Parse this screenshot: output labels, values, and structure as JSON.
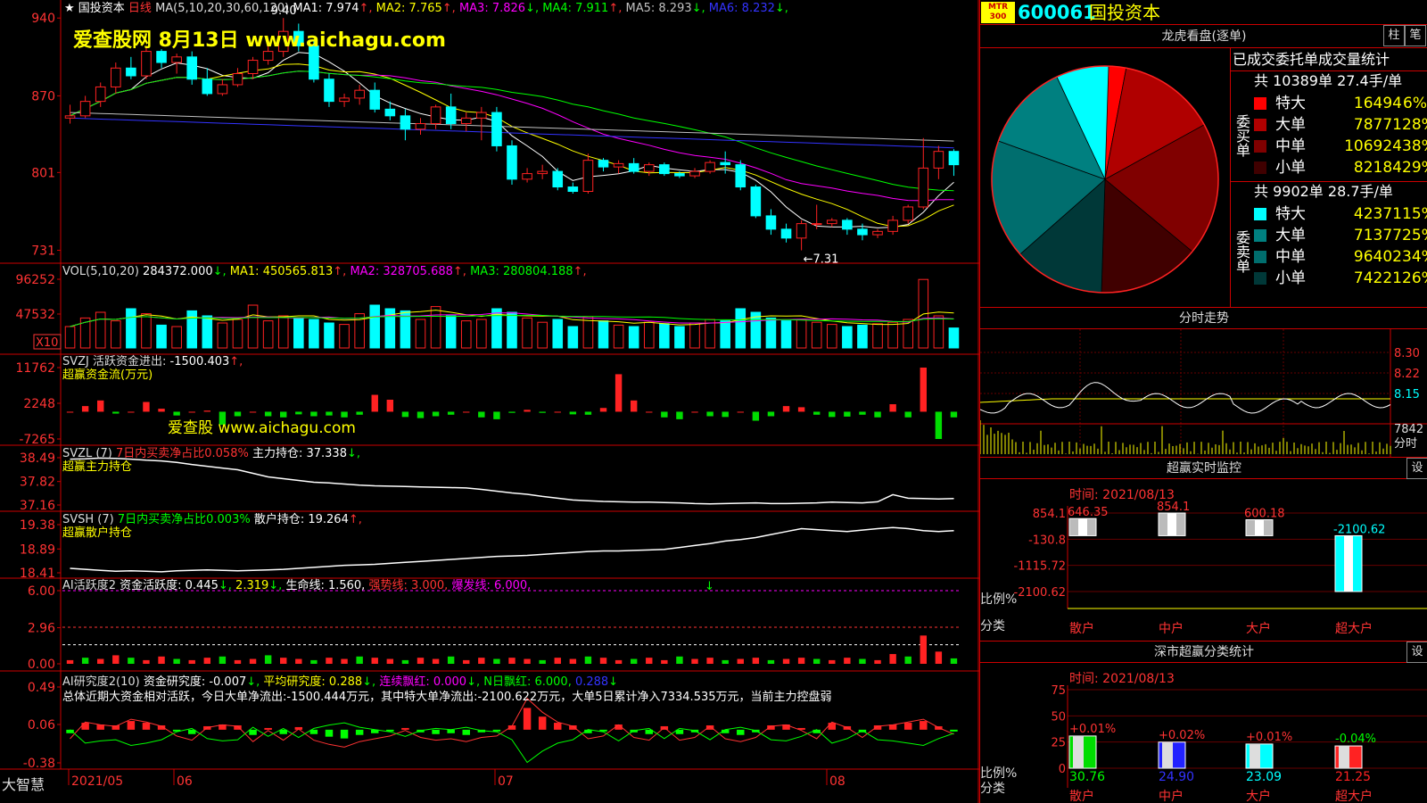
{
  "app": {
    "name": "大智慧",
    "stock_name": "国投资本",
    "period": "日线",
    "watermark": "爱查股网    8月13日   www.aichagu.com",
    "watermark2": "爱查股 www.aichagu.com"
  },
  "colors": {
    "up": "#ff2222",
    "down": "#00ffff",
    "ma1": "#ffffff",
    "ma2": "#ffff00",
    "ma3": "#ff00ff",
    "ma4": "#00ff00",
    "ma5": "#c0c0c0",
    "ma6": "#3333ff"
  },
  "price_panel": {
    "title": "国投资本",
    "ma_label": "MA(5,10,20,30,60,120)",
    "ma_values": [
      {
        "label": "MA1:",
        "value": "7.974",
        "arrow": "↑",
        "color": "#ffffff"
      },
      {
        "label": "MA2:",
        "value": "7.765",
        "arrow": "↑",
        "color": "#ffff00"
      },
      {
        "label": "MA3:",
        "value": "7.826",
        "arrow": "↓",
        "color": "#ff00ff"
      },
      {
        "label": "MA4:",
        "value": "7.911",
        "arrow": "↑",
        "color": "#00ff00"
      },
      {
        "label": "MA5:",
        "value": "8.293",
        "arrow": "↓",
        "color": "#c0c0c0"
      },
      {
        "label": "MA6:",
        "value": "8.232",
        "arrow": "↓",
        "color": "#3333ff"
      }
    ],
    "high_label": "9.40",
    "low_label": "←7.31",
    "yticks": [
      "940",
      "870",
      "801",
      "731"
    ]
  },
  "vol_panel": {
    "label": "VOL(5,10,20)",
    "value": "284372.000",
    "arrow": "↓",
    "ma": [
      {
        "label": "MA1:",
        "value": "450565.813",
        "arrow": "↑",
        "color": "#ffff00"
      },
      {
        "label": "MA2:",
        "value": "328705.688",
        "arrow": "↑",
        "color": "#ff00ff"
      },
      {
        "label": "MA3:",
        "value": "280804.188",
        "arrow": "↑",
        "color": "#00ff00"
      }
    ],
    "yticks": [
      "96252",
      "47532"
    ],
    "unit": "X10"
  },
  "svzj_panel": {
    "label": "SVZJ  活跃资金进出:",
    "value": "-1500.403",
    "arrow": "↑",
    "sub": "超赢资金流(万元)",
    "yticks": [
      "11762",
      "2248",
      "-7265"
    ]
  },
  "svzl_panel": {
    "label": "SVZL (7)",
    "desc": "7日内买卖净占比0.058%",
    "extra": "主力持仓:",
    "value": "37.338",
    "arrow": "↓",
    "sub": "超赢主力持仓",
    "yticks": [
      "38.49",
      "37.82",
      "37.16"
    ]
  },
  "svsh_panel": {
    "label": "SVSH (7)",
    "desc": "7日内买卖净占比0.003%",
    "extra": "散户持仓:",
    "value": "19.264",
    "arrow": "↑",
    "sub": "超赢散户持仓",
    "yticks": [
      "19.38",
      "18.89",
      "18.41"
    ]
  },
  "ai1_panel": {
    "label": "AI活跃度2",
    "text1": "资金活跃度:",
    "v1": "0.445",
    "v2": "2.319",
    "text2": "生命线:",
    "v3": "1.560",
    "text3": "强势线:",
    "v4": "3.000",
    "text4": "爆发线:",
    "v5": "6.000",
    "yticks": [
      "6.00",
      "2.96",
      "0.00"
    ]
  },
  "ai2_panel": {
    "label": "AI研究度2(10)",
    "text1": "资金研究度:",
    "v1": "-0.007",
    "text2": "平均研究度:",
    "v2": "0.288",
    "text3": "连续飘红:",
    "v3": "0.000",
    "text4": "N日飘红:",
    "v4": "6.000",
    "v5": "0.288",
    "summary": "总体近期大资金相对活跃，今日大单净流出:-1500.444万元，其中特大单净流出:-2100.622万元，大单5日累计净入7334.535万元，当前主力控盘弱",
    "yticks": [
      "0.49",
      "0.06",
      "-0.38"
    ]
  },
  "xaxis": {
    "labels": [
      "2021/05",
      "06",
      "07",
      "08"
    ]
  },
  "right": {
    "code": "600061",
    "name": "国投资本",
    "tag": "MTR 300",
    "dragon_title": "龙虎看盘(逐单)",
    "btn1": "柱",
    "btn2": "笔",
    "order_title": "已成交委托单成交量统计",
    "buy": {
      "side": "委买单",
      "summary": "共 10389单 27.4手/单",
      "rows": [
        {
          "name": "特大",
          "vol": "16494",
          "pct": "6%",
          "color": "#ff0000"
        },
        {
          "name": "大单",
          "vol": "78771",
          "pct": "28%",
          "color": "#b00000"
        },
        {
          "name": "中单",
          "vol": "106924",
          "pct": "38%",
          "color": "#800000"
        },
        {
          "name": "小单",
          "vol": "82184",
          "pct": "29%",
          "color": "#400000"
        }
      ]
    },
    "sell": {
      "side": "委卖单",
      "summary": "共 9902单 28.7手/单",
      "rows": [
        {
          "name": "特大",
          "vol": "42371",
          "pct": "15%",
          "color": "#00ffff"
        },
        {
          "name": "大单",
          "vol": "71377",
          "pct": "25%",
          "color": "#008080"
        },
        {
          "name": "中单",
          "vol": "96402",
          "pct": "34%",
          "color": "#006e6e"
        },
        {
          "name": "小单",
          "vol": "74221",
          "pct": "26%",
          "color": "#003838"
        }
      ]
    },
    "intraday": {
      "title": "分时走势",
      "prices": [
        "8.30",
        "8.22",
        "8.15"
      ],
      "vol": "7842",
      "unit": "分时"
    },
    "monitor": {
      "title": "超赢实时监控",
      "btn": "设",
      "time": "时间: 2021/08/13",
      "ylabels": [
        "854.1",
        "-130.8",
        "-1115.72",
        "-2100.62"
      ],
      "ratio": "比例%",
      "cat": "分类",
      "bars": [
        {
          "name": "散户",
          "value": 646.35,
          "label": "646.35"
        },
        {
          "name": "中户",
          "value": 854.1,
          "label": "854.1"
        },
        {
          "name": "大户",
          "value": 600.18,
          "label": "600.18"
        },
        {
          "name": "超大户",
          "value": -2100.62,
          "label": "-2100.62"
        }
      ]
    },
    "stats": {
      "title": "深市超赢分类统计",
      "btn": "设",
      "time": "时间: 2021/08/13",
      "ylabels": [
        "75",
        "50",
        "25",
        "0"
      ],
      "ratio": "比例%",
      "cat": "分类",
      "bars": [
        {
          "name": "散户",
          "value": 30.76,
          "change": "+0.01%",
          "color": "#00dd00"
        },
        {
          "name": "中户",
          "value": 24.9,
          "change": "+0.02%",
          "color": "#2222ff"
        },
        {
          "name": "大户",
          "value": 23.09,
          "change": "+0.01%",
          "color": "#00ffff"
        },
        {
          "name": "超大户",
          "value": 21.25,
          "change": "-0.04%",
          "color": "#ff2222"
        }
      ]
    }
  },
  "chart_data": {
    "type": "candlestick",
    "title": "国投资本 日线",
    "xlabel": "",
    "ylabel": "",
    "ylim": [
      7.25,
      9.45
    ],
    "ohlc": [
      [
        8.5,
        8.62,
        8.45,
        8.52
      ],
      [
        8.52,
        8.7,
        8.5,
        8.65
      ],
      [
        8.65,
        8.82,
        8.6,
        8.78
      ],
      [
        8.78,
        9.0,
        8.72,
        8.95
      ],
      [
        8.95,
        9.05,
        8.85,
        8.88
      ],
      [
        8.88,
        9.15,
        8.85,
        9.1
      ],
      [
        9.1,
        9.12,
        8.95,
        9.0
      ],
      [
        9.0,
        9.08,
        8.9,
        9.05
      ],
      [
        9.05,
        9.1,
        8.8,
        8.85
      ],
      [
        8.85,
        8.95,
        8.7,
        8.72
      ],
      [
        8.72,
        8.85,
        8.7,
        8.8
      ],
      [
        8.8,
        8.95,
        8.78,
        8.9
      ],
      [
        8.9,
        9.05,
        8.85,
        9.02
      ],
      [
        9.02,
        9.15,
        8.98,
        9.1
      ],
      [
        9.1,
        9.4,
        9.05,
        9.28
      ],
      [
        9.28,
        9.35,
        9.1,
        9.15
      ],
      [
        9.15,
        9.2,
        8.82,
        8.85
      ],
      [
        8.85,
        8.9,
        8.6,
        8.65
      ],
      [
        8.65,
        8.72,
        8.6,
        8.68
      ],
      [
        8.68,
        8.8,
        8.62,
        8.75
      ],
      [
        8.75,
        8.82,
        8.55,
        8.58
      ],
      [
        8.58,
        8.65,
        8.48,
        8.52
      ],
      [
        8.52,
        8.58,
        8.3,
        8.4
      ],
      [
        8.4,
        8.5,
        8.35,
        8.45
      ],
      [
        8.45,
        8.62,
        8.4,
        8.6
      ],
      [
        8.6,
        8.72,
        8.4,
        8.45
      ],
      [
        8.45,
        8.55,
        8.38,
        8.5
      ],
      [
        8.5,
        8.6,
        8.3,
        8.55
      ],
      [
        8.55,
        8.6,
        8.2,
        8.25
      ],
      [
        8.25,
        8.3,
        7.9,
        7.95
      ],
      [
        7.95,
        8.05,
        7.92,
        8.0
      ],
      [
        8.0,
        8.08,
        7.95,
        8.02
      ],
      [
        8.02,
        8.05,
        7.85,
        7.88
      ],
      [
        7.88,
        7.92,
        7.82,
        7.84
      ],
      [
        7.84,
        8.18,
        7.82,
        8.12
      ],
      [
        8.12,
        8.14,
        8.02,
        8.06
      ],
      [
        8.06,
        8.12,
        8.0,
        8.09
      ],
      [
        8.09,
        8.14,
        8.0,
        8.02
      ],
      [
        8.02,
        8.1,
        7.98,
        8.08
      ],
      [
        8.08,
        8.1,
        7.98,
        8.0
      ],
      [
        8.0,
        8.02,
        7.96,
        7.98
      ],
      [
        7.98,
        8.05,
        7.96,
        8.02
      ],
      [
        8.02,
        8.12,
        8.0,
        8.1
      ],
      [
        8.1,
        8.2,
        8.0,
        8.08
      ],
      [
        8.08,
        8.12,
        7.85,
        7.88
      ],
      [
        7.88,
        7.9,
        7.6,
        7.62
      ],
      [
        7.62,
        7.68,
        7.45,
        7.5
      ],
      [
        7.5,
        7.55,
        7.38,
        7.42
      ],
      [
        7.42,
        7.58,
        7.31,
        7.55
      ],
      [
        7.55,
        7.72,
        7.5,
        7.55
      ],
      [
        7.55,
        7.6,
        7.52,
        7.58
      ],
      [
        7.58,
        7.6,
        7.45,
        7.5
      ],
      [
        7.5,
        7.55,
        7.4,
        7.45
      ],
      [
        7.45,
        7.5,
        7.42,
        7.48
      ],
      [
        7.48,
        7.62,
        7.45,
        7.58
      ],
      [
        7.58,
        7.72,
        7.55,
        7.7
      ],
      [
        7.7,
        8.32,
        7.68,
        8.05
      ],
      [
        8.05,
        8.25,
        7.95,
        8.2
      ],
      [
        8.2,
        8.22,
        7.98,
        8.08
      ]
    ],
    "volume_x10": [
      30000,
      42000,
      50000,
      38000,
      55000,
      48000,
      32000,
      30000,
      52000,
      45000,
      35000,
      40000,
      60000,
      38000,
      45000,
      42000,
      40000,
      35000,
      33000,
      48000,
      60000,
      55000,
      52000,
      40000,
      58000,
      45000,
      38000,
      40000,
      55000,
      50000,
      42000,
      36000,
      40000,
      30000,
      44000,
      38000,
      32000,
      30000,
      36000,
      34000,
      30000,
      35000,
      40000,
      38000,
      55000,
      50000,
      42000,
      38000,
      40000,
      36000,
      33000,
      30000,
      32000,
      34000,
      36000,
      40000,
      96000,
      45000,
      28000
    ],
    "svzj": [
      0,
      1500,
      3000,
      -500,
      0,
      2600,
      800,
      -1000,
      0,
      300,
      -3500,
      -1200,
      0,
      -1200,
      -1500,
      -700,
      -1200,
      -1000,
      -1500,
      -800,
      4500,
      3200,
      -1400,
      -1700,
      -1200,
      -800,
      0,
      -1500,
      -2000,
      -300,
      500,
      -300,
      0,
      -700,
      -800,
      1000,
      10000,
      3000,
      0,
      -1500,
      -2000,
      0,
      -1200,
      -1400,
      0,
      -2400,
      -1200,
      1500,
      1200,
      -800,
      -1400,
      -1300,
      -800,
      -1500,
      2000,
      -1500,
      11762,
      -7265,
      -1500
    ],
    "svzl": [
      38.45,
      38.46,
      38.48,
      38.47,
      38.45,
      38.42,
      38.4,
      38.36,
      38.3,
      38.25,
      38.2,
      38.15,
      38.05,
      37.95,
      37.9,
      37.85,
      37.8,
      37.78,
      37.75,
      37.72,
      37.7,
      37.69,
      37.68,
      37.67,
      37.66,
      37.65,
      37.64,
      37.6,
      37.55,
      37.5,
      37.46,
      37.4,
      37.35,
      37.3,
      37.28,
      37.26,
      37.25,
      37.24,
      37.24,
      37.23,
      37.22,
      37.2,
      37.19,
      37.2,
      37.21,
      37.22,
      37.2,
      37.2,
      37.21,
      37.22,
      37.24,
      37.23,
      37.22,
      37.25,
      37.45,
      37.35,
      37.34,
      37.33,
      37.34
    ],
    "svsh": [
      18.5,
      18.48,
      18.46,
      18.44,
      18.45,
      18.44,
      18.43,
      18.45,
      18.46,
      18.47,
      18.46,
      18.45,
      18.46,
      18.47,
      18.48,
      18.5,
      18.52,
      18.54,
      18.56,
      18.57,
      18.58,
      18.6,
      18.62,
      18.64,
      18.66,
      18.68,
      18.7,
      18.72,
      18.74,
      18.75,
      18.76,
      18.78,
      18.8,
      18.82,
      18.84,
      18.85,
      18.85,
      18.86,
      18.87,
      18.88,
      18.92,
      18.96,
      19.0,
      19.05,
      19.08,
      19.12,
      19.18,
      19.24,
      19.3,
      19.28,
      19.26,
      19.24,
      19.27,
      19.3,
      19.32,
      19.3,
      19.26,
      19.24,
      19.26
    ],
    "ai1": [
      0.3,
      0.5,
      0.4,
      0.7,
      0.5,
      0.3,
      0.6,
      0.4,
      0.3,
      0.5,
      0.6,
      0.3,
      0.4,
      0.7,
      0.5,
      0.4,
      0.3,
      0.5,
      0.4,
      0.6,
      0.5,
      0.4,
      0.3,
      0.5,
      0.4,
      0.6,
      0.3,
      0.5,
      0.4,
      0.5,
      0.4,
      0.3,
      0.5,
      0.4,
      0.6,
      0.5,
      0.3,
      0.4,
      0.5,
      0.3,
      0.6,
      0.4,
      0.5,
      0.3,
      0.4,
      0.5,
      0.3,
      0.4,
      0.5,
      0.4,
      0.3,
      0.5,
      0.4,
      0.3,
      0.8,
      0.6,
      2.319,
      1.0,
      0.445
    ],
    "ai2": [
      -0.04,
      0.08,
      0.06,
      0.05,
      0.1,
      0.08,
      0.05,
      -0.02,
      -0.05,
      0.04,
      0.06,
      0.05,
      -0.06,
      0.02,
      -0.05,
      0.03,
      -0.05,
      -0.08,
      -0.1,
      -0.06,
      -0.04,
      -0.02,
      0.02,
      -0.03,
      -0.05,
      -0.04,
      -0.06,
      -0.03,
      -0.02,
      0.05,
      0.25,
      0.15,
      0.08,
      0.05,
      -0.04,
      -0.02,
      0.06,
      -0.03,
      -0.05,
      0.04,
      -0.05,
      -0.03,
      0.05,
      -0.04,
      -0.06,
      -0.03,
      0.05,
      0.06,
      0.02,
      -0.04,
      0.08,
      0.04,
      -0.03,
      0.05,
      0.06,
      0.08,
      0.1,
      0.04,
      -0.007
    ],
    "xlabels": [
      "2021/05",
      "06",
      "07",
      "08"
    ],
    "pie": {
      "buy": [
        6,
        28,
        38,
        29
      ],
      "sell": [
        15,
        25,
        34,
        26
      ]
    }
  }
}
